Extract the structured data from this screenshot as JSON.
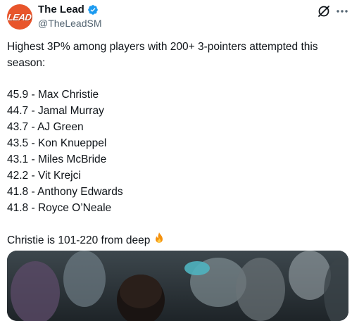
{
  "tweet": {
    "display_name": "The Lead",
    "handle": "@TheLeadSM",
    "avatar_text": "LEAD",
    "intro_line1": "Highest 3P% among players with 200+ 3-pointers attempted this",
    "intro_line2": "season:",
    "stats": [
      "45.9 - Max Christie",
      "44.7 - Jamal Murray",
      "43.7 - AJ Green",
      "43.5 - Kon Knueppel",
      "43.1 - Miles McBride",
      "42.2 - Vit Krejci",
      "41.8 - Anthony Edwards",
      "41.8 - Royce O’Neale"
    ],
    "closing": "Christie is 101-220 from deep"
  },
  "icons": {
    "verified": "verified-badge-icon",
    "grok": "grok-icon",
    "more": "more-options-icon",
    "fire": "fire-emoji"
  },
  "colors": {
    "brand_avatar": "#e8552b",
    "verified": "#1d9bf0",
    "text": "#0f1419",
    "secondary_text": "#536471"
  }
}
